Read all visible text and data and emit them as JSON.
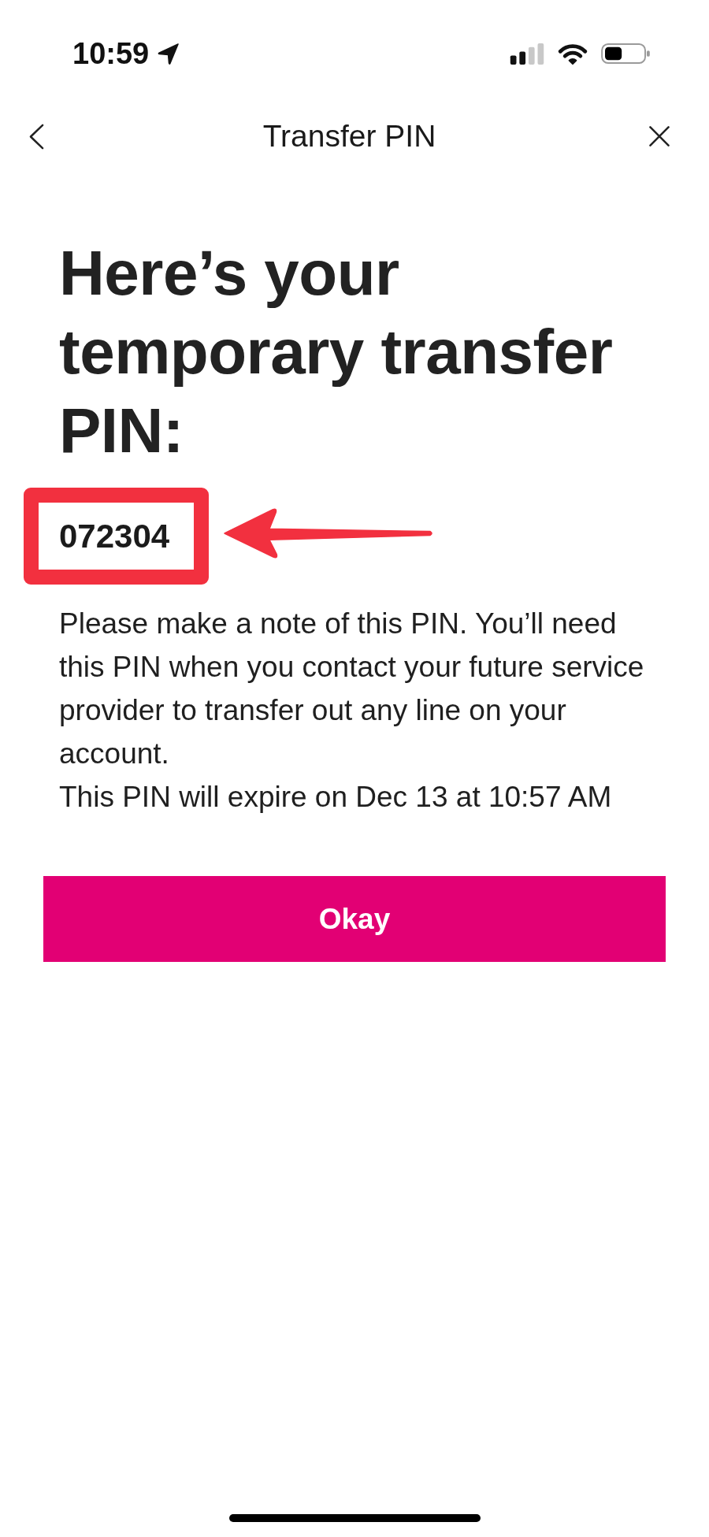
{
  "status_bar": {
    "time": "10:59"
  },
  "nav": {
    "title": "Transfer PIN"
  },
  "heading": "Here’s your temporary transfer PIN:",
  "pin": {
    "code": "072304"
  },
  "message": "Please make a note of this PIN. You’ll need this PIN when you contact your future service provider to transfer out any line on your account.",
  "expiry": "This PIN will expire on Dec 13 at 10:57 AM",
  "primary_button": {
    "label": "Okay"
  }
}
